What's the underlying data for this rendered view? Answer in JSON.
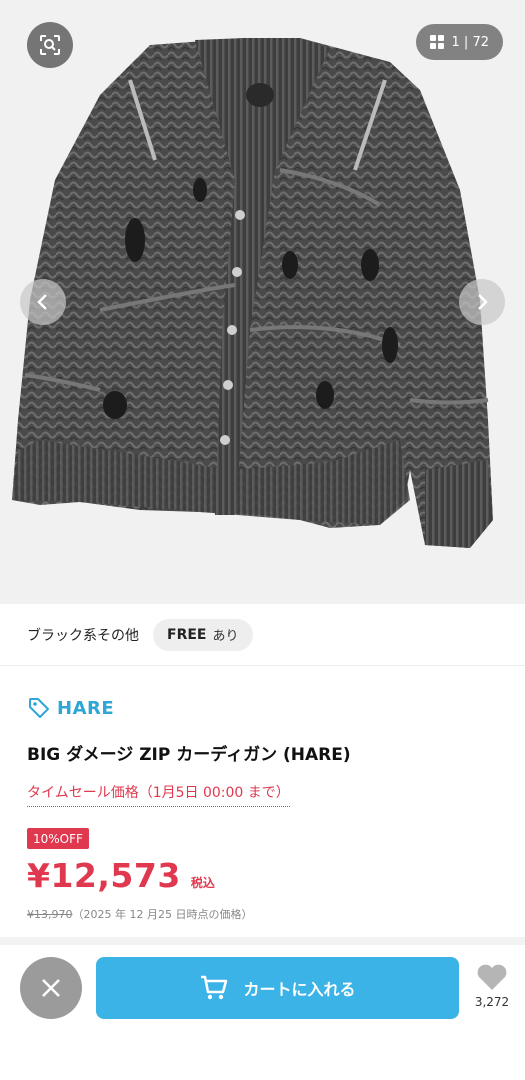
{
  "gallery": {
    "counter_text": "1 | 72",
    "image_alt": "BIG ダメージ ZIP カーディガン"
  },
  "icons": {
    "zoom": "zoom-search-icon",
    "grid": "grid-icon",
    "prev": "chevron-left-icon",
    "next": "chevron-right-icon",
    "tag": "tag-icon",
    "close": "close-icon",
    "cart": "cart-icon",
    "heart": "heart-icon"
  },
  "variant": {
    "color": "ブラック系その他",
    "size": "FREE",
    "stock": "あり"
  },
  "product": {
    "brand": "HARE",
    "title": "BIG ダメージ ZIP カーディガン (HARE)",
    "sale_label": "タイムセール価格（1月5日 00:00 まで）",
    "discount_badge": "10%OFF",
    "price": "¥12,573",
    "tax_label": "税込",
    "old_price": "¥13,970",
    "old_price_note": "（2025 年 12 月25 日時点の価格）"
  },
  "bottom": {
    "cart_label": "カートに入れる",
    "favorite_count": "3,272"
  },
  "colors": {
    "accent_blue": "#3bb3e6",
    "brand_blue": "#2ea6d6",
    "sale_red": "#e0384f",
    "close_gray": "#9b9b9b"
  }
}
